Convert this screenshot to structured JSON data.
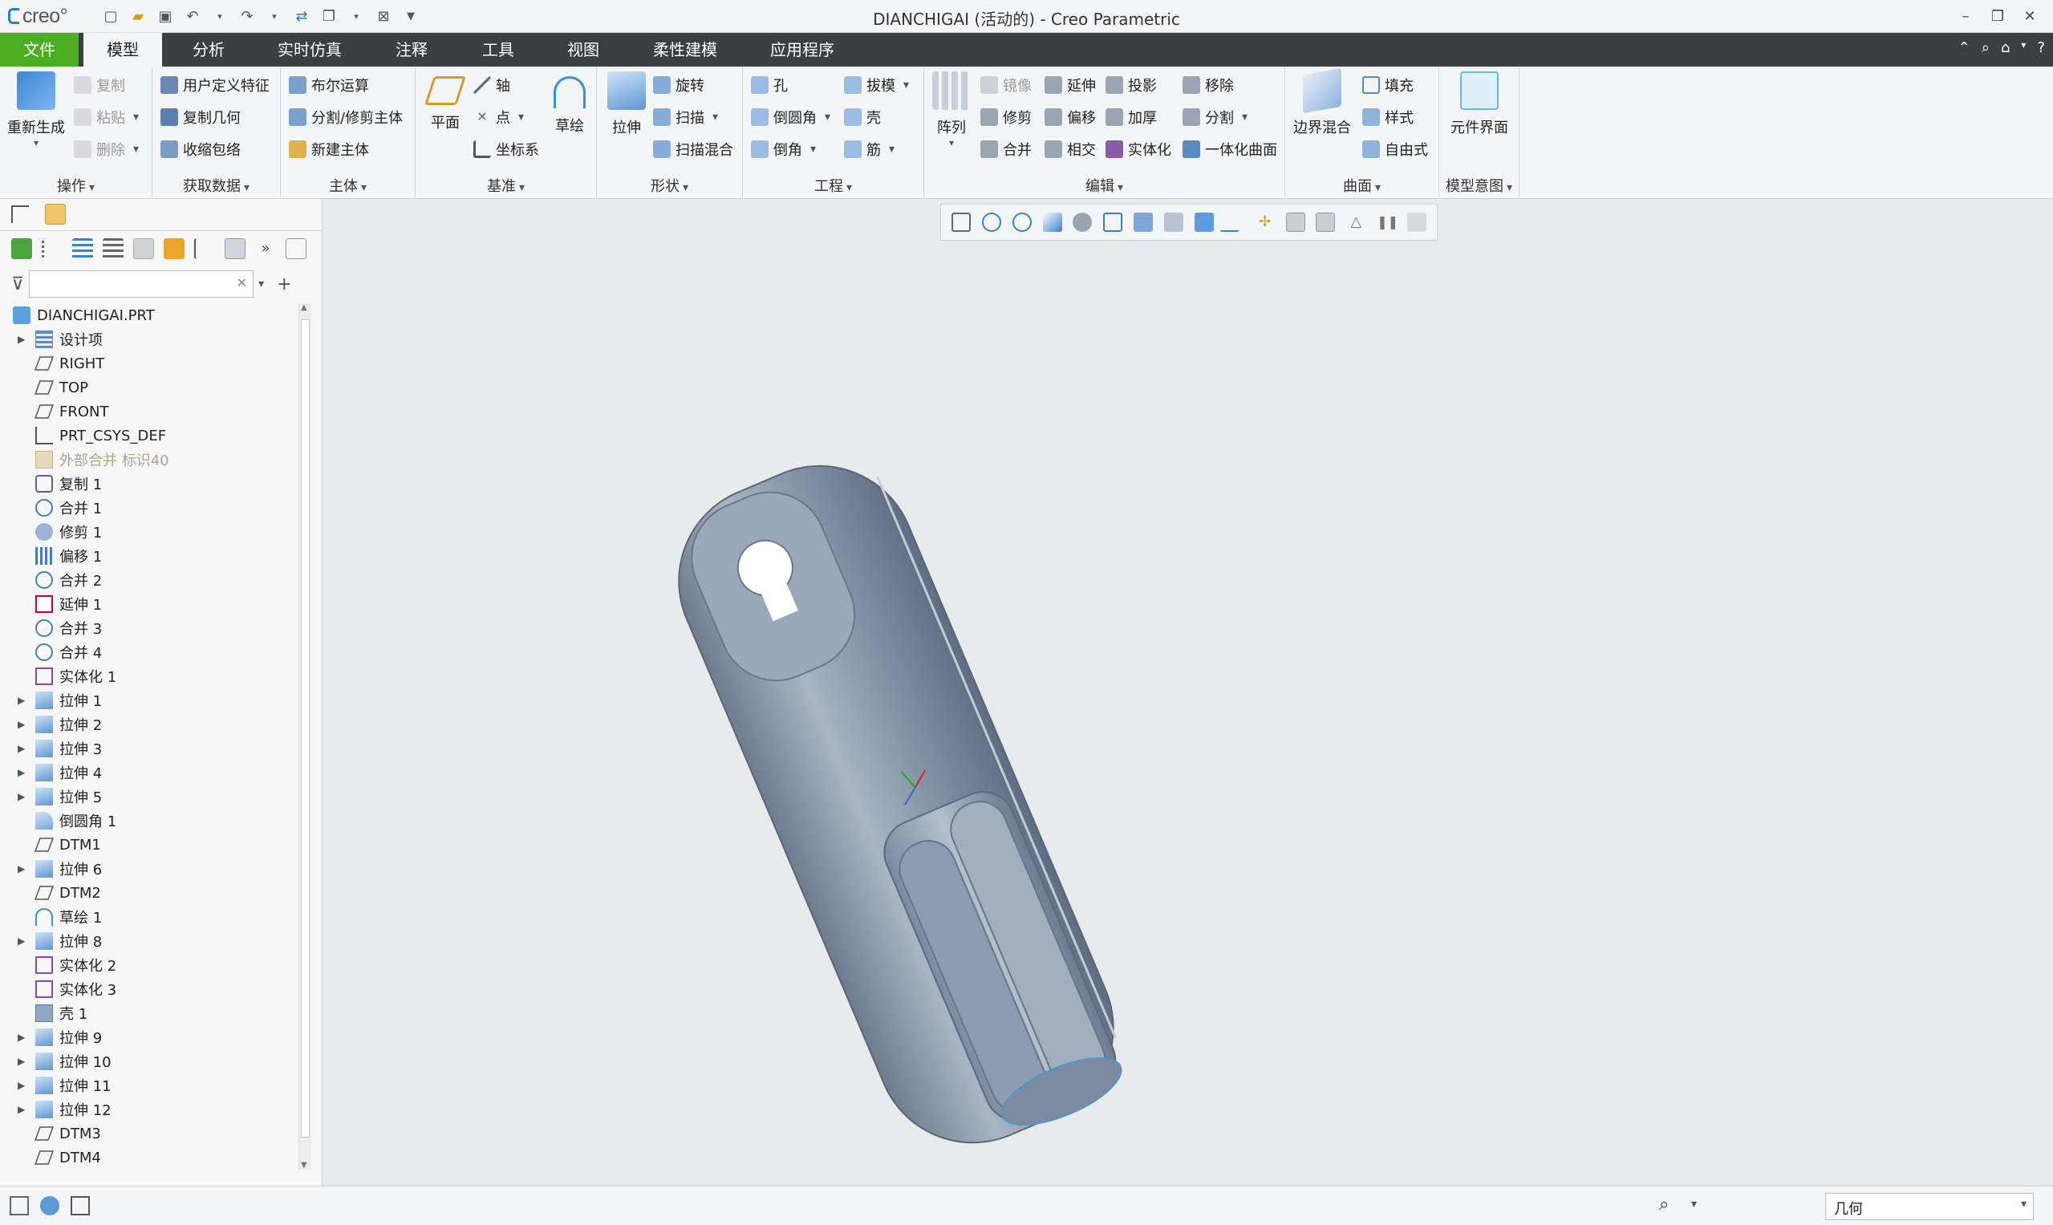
{
  "app": {
    "logo_text": "creo°",
    "window_title": "DIANCHIGAI (活动的) - Creo Parametric"
  },
  "tabs": [
    "文件",
    "模型",
    "分析",
    "实时仿真",
    "注释",
    "工具",
    "视图",
    "柔性建模",
    "应用程序"
  ],
  "ribbon": {
    "operations": {
      "label": "操作",
      "regenerate": "重新生成",
      "copy": "复制",
      "paste": "粘贴",
      "delete": "删除"
    },
    "get_data": {
      "label": "获取数据",
      "udf": "用户定义特征",
      "copy_geom": "复制几何",
      "shrinkwrap": "收缩包络"
    },
    "body": {
      "label": "主体",
      "boolean": "布尔运算",
      "split_trim": "分割/修剪主体",
      "new_body": "新建主体"
    },
    "datum": {
      "label": "基准",
      "plane": "平面",
      "axis": "轴",
      "point": "点",
      "csys": "坐标系",
      "sketch": "草绘"
    },
    "shapes": {
      "label": "形状",
      "extrude": "拉伸",
      "revolve": "旋转",
      "sweep": "扫描",
      "swept_blend": "扫描混合"
    },
    "engineering": {
      "label": "工程",
      "hole": "孔",
      "round": "倒圆角",
      "chamfer": "倒角",
      "draft": "拔模",
      "shell": "壳",
      "rib": "筋"
    },
    "editing": {
      "label": "编辑",
      "pattern": "阵列",
      "mirror": "镜像",
      "trim": "修剪",
      "merge": "合并",
      "extend": "延伸",
      "offset": "偏移",
      "intersect": "相交",
      "project": "投影",
      "thicken": "加厚",
      "solidify": "实体化",
      "remove": "移除",
      "split": "分割",
      "unify_surface": "一体化曲面"
    },
    "surfaces": {
      "label": "曲面",
      "boundary_blend": "边界混合",
      "fill": "填充",
      "style": "样式",
      "freestyle": "自由式"
    },
    "model_intent": {
      "label": "模型意图",
      "component_interface": "元件界面"
    }
  },
  "tree": {
    "root": "DIANCHIGAI.PRT",
    "items": [
      {
        "label": "设计项",
        "icon": "design-items-icon",
        "expandable": true
      },
      {
        "label": "RIGHT",
        "icon": "datum-plane-icon",
        "expandable": false
      },
      {
        "label": "TOP",
        "icon": "datum-plane-icon",
        "expandable": false
      },
      {
        "label": "FRONT",
        "icon": "datum-plane-icon",
        "expandable": false
      },
      {
        "label": "PRT_CSYS_DEF",
        "icon": "csys-icon",
        "expandable": false
      },
      {
        "label": "外部合并 标识40",
        "icon": "external-merge-icon",
        "expandable": false,
        "dim": true
      },
      {
        "label": "复制 1",
        "icon": "copy-feature-icon",
        "expandable": false
      },
      {
        "label": "合并 1",
        "icon": "merge-icon",
        "expandable": false
      },
      {
        "label": "修剪 1",
        "icon": "trim-icon",
        "expandable": false
      },
      {
        "label": "偏移 1",
        "icon": "offset-icon",
        "expandable": false
      },
      {
        "label": "合并 2",
        "icon": "merge-icon",
        "expandable": false
      },
      {
        "label": "延伸 1",
        "icon": "extend-icon",
        "expandable": false
      },
      {
        "label": "合并 3",
        "icon": "merge-icon",
        "expandable": false
      },
      {
        "label": "合并 4",
        "icon": "merge-icon",
        "expandable": false
      },
      {
        "label": "实体化 1",
        "icon": "solidify-icon",
        "expandable": false
      },
      {
        "label": "拉伸 1",
        "icon": "extrude-icon",
        "expandable": true
      },
      {
        "label": "拉伸 2",
        "icon": "extrude-icon",
        "expandable": true
      },
      {
        "label": "拉伸 3",
        "icon": "extrude-icon",
        "expandable": true
      },
      {
        "label": "拉伸 4",
        "icon": "extrude-icon",
        "expandable": true
      },
      {
        "label": "拉伸 5",
        "icon": "extrude-icon",
        "expandable": true
      },
      {
        "label": "倒圆角 1",
        "icon": "round-icon",
        "expandable": false
      },
      {
        "label": "DTM1",
        "icon": "datum-plane-icon",
        "expandable": false
      },
      {
        "label": "拉伸 6",
        "icon": "extrude-icon",
        "expandable": true
      },
      {
        "label": "DTM2",
        "icon": "datum-plane-icon",
        "expandable": false
      },
      {
        "label": "草绘 1",
        "icon": "sketch-icon",
        "expandable": false
      },
      {
        "label": "拉伸 8",
        "icon": "extrude-icon",
        "expandable": true
      },
      {
        "label": "实体化 2",
        "icon": "solidify-icon",
        "expandable": false
      },
      {
        "label": "实体化 3",
        "icon": "solidify-icon",
        "expandable": false
      },
      {
        "label": "壳 1",
        "icon": "shell-icon",
        "expandable": false
      },
      {
        "label": "拉伸 9",
        "icon": "extrude-icon",
        "expandable": true
      },
      {
        "label": "拉伸 10",
        "icon": "extrude-icon",
        "expandable": true
      },
      {
        "label": "拉伸 11",
        "icon": "extrude-icon",
        "expandable": true
      },
      {
        "label": "拉伸 12",
        "icon": "extrude-icon",
        "expandable": true
      },
      {
        "label": "DTM3",
        "icon": "datum-plane-icon",
        "expandable": false
      },
      {
        "label": "DTM4",
        "icon": "datum-plane-icon",
        "expandable": false
      }
    ]
  },
  "filter": {
    "search_value": ""
  },
  "status": {
    "selection_filter": "几何"
  },
  "colors": {
    "file_tab": "#4caf22",
    "tab_bar": "#3b3e42",
    "model": "#8e9cb0",
    "accent": "#2b7bd6"
  }
}
